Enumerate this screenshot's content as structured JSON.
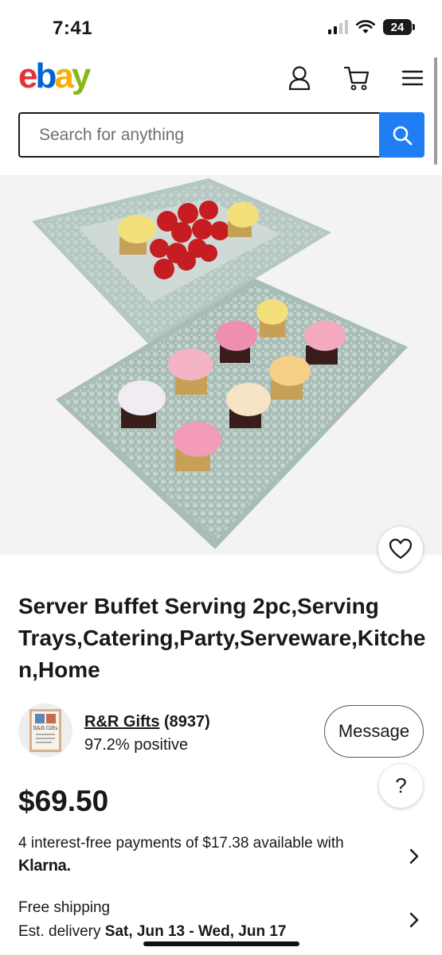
{
  "status_bar": {
    "time": "7:41",
    "battery": "24"
  },
  "header": {
    "logo": {
      "e": "e",
      "b": "b",
      "a": "a",
      "y": "y"
    },
    "icons": [
      "account-icon",
      "cart-icon",
      "menu-icon"
    ]
  },
  "search": {
    "placeholder": "Search for anything",
    "button_icon": "search-icon"
  },
  "product": {
    "title": "Server Buffet Serving 2pc,Serving Trays,Catering,Party,Serveware,Kitchen,Home",
    "price": "$69.50"
  },
  "seller": {
    "name": "R&R Gifts",
    "feedback_count": "(8937)",
    "positive": "97.2% positive",
    "avatar_text": "R&R Gifts",
    "message_label": "Message"
  },
  "help": {
    "label": "?"
  },
  "payments": {
    "text": "4 interest-free payments of $17.38 available with",
    "provider": "Klarna."
  },
  "shipping": {
    "line1": "Free shipping",
    "line2_prefix": "Est. delivery ",
    "line2_dates": "Sat, Jun 13 - Wed, Jun 17"
  },
  "colors": {
    "ebay_red": "#e53238",
    "ebay_blue": "#0064d2",
    "ebay_yellow": "#f5af02",
    "ebay_green": "#86b817",
    "search_button": "#1f7ef3"
  }
}
